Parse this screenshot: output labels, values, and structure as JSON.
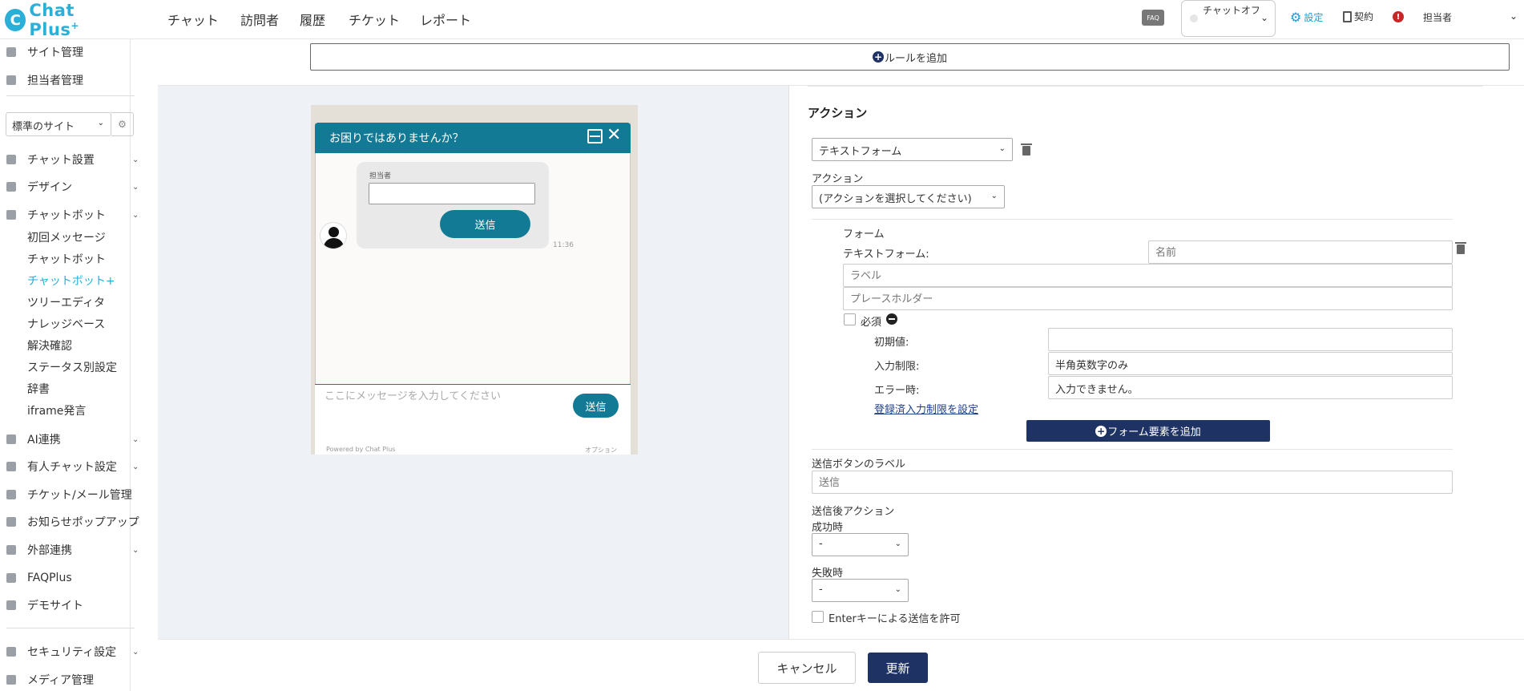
{
  "app": {
    "logo_text": "Chat Plus",
    "logo_plus": "+"
  },
  "topnav": [
    "チャット",
    "訪問者",
    "履歴",
    "チケット",
    "レポート"
  ],
  "header": {
    "faq_label": "FAQ",
    "status_label": "チャットオフ",
    "settings_label": "設定",
    "contract_label": "契約",
    "alert_glyph": "!",
    "user_label": "担当者"
  },
  "sidebar": {
    "top_items": [
      "サイト管理",
      "担当者管理"
    ],
    "site_select": "標準のサイト",
    "items": [
      {
        "label": "チャット設置",
        "chev": "⌄"
      },
      {
        "label": "デザイン",
        "chev": "⌄"
      },
      {
        "label": "チャットボット",
        "chev": "⌄"
      }
    ],
    "sub_items": [
      "初回メッセージ",
      "チャットボット",
      "チャットボット+",
      "ツリーエディタ",
      "ナレッジベース",
      "解決確認",
      "ステータス別設定",
      "辞書",
      "iframe発言"
    ],
    "active_sub": "チャットボット+",
    "lower_items": [
      {
        "label": "AI連携",
        "chev": "⌄"
      },
      {
        "label": "有人チャット設定",
        "chev": "⌄"
      },
      {
        "label": "チケット/メール管理",
        "chev": ""
      },
      {
        "label": "お知らせポップアップ",
        "chev": "⌄"
      },
      {
        "label": "外部連携",
        "chev": "⌄"
      },
      {
        "label": "FAQPlus",
        "chev": ""
      },
      {
        "label": "デモサイト",
        "chev": ""
      }
    ],
    "bottom_items": [
      {
        "label": "セキュリティ設定",
        "chev": "⌄"
      },
      {
        "label": "メディア管理",
        "chev": ""
      }
    ]
  },
  "main": {
    "add_rule_label": "ルールを追加",
    "widget": {
      "title": "お困りではありませんか？",
      "form_label": "担当者",
      "submit_label": "送信",
      "time": "11:36",
      "input_placeholder": "ここにメッセージを入力してください",
      "send_label": "送信",
      "powered": "Powered by Chat Plus",
      "option": "オプション"
    },
    "action_title": "アクション",
    "type_select": "テキストフォーム",
    "action_label": "アクション",
    "action_select": "(アクションを選択してください)",
    "form_heading": "フォーム",
    "text_form_label": "テキストフォーム:",
    "name_placeholder": "名前",
    "label_placeholder": "ラベル",
    "placeholder_placeholder": "プレースホルダー",
    "required_label": "必須",
    "initial_label": "初期値:",
    "initial_value": "",
    "restriction_label": "入力制限:",
    "restriction_value": "半角英数字のみ",
    "error_label": "エラー時:",
    "error_value": "入力できません。",
    "register_link": "登録済入力制限を設定",
    "add_form_element_label": "フォーム要素を追加",
    "submit_button_label_heading": "送信ボタンのラベル",
    "submit_button_label_placeholder": "送信",
    "after_submit_heading": "送信後アクション",
    "success_label": "成功時",
    "success_value": "-",
    "failure_label": "失敗時",
    "failure_value": "-",
    "enter_submit_label": "Enterキーによる送信を許可"
  },
  "footer": {
    "cancel_label": "キャンセル",
    "update_label": "更新"
  },
  "colors": {
    "brand": "#2ab0d8",
    "widget_teal": "#127a94",
    "primary_navy": "#1e3264",
    "active_link": "#1fb0d8"
  }
}
